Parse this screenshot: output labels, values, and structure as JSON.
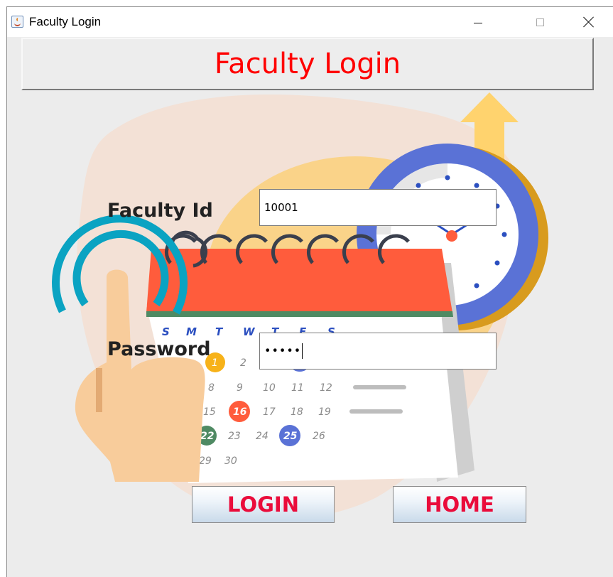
{
  "window": {
    "title": "Faculty Login",
    "icon": "java-cup-icon",
    "controls": [
      "minimize",
      "maximize",
      "close"
    ]
  },
  "header": {
    "title": "Faculty Login",
    "color": "#ff0000"
  },
  "form": {
    "faculty_id": {
      "label": "Faculty Id",
      "value": "10001"
    },
    "password": {
      "label": "Password",
      "masked_value": "•••••"
    }
  },
  "buttons": {
    "login": "LOGIN",
    "home": "HOME"
  },
  "illustration": {
    "description_icons": [
      "calendar-icon",
      "clock-icon",
      "hand-touch-icon",
      "up-arrow-icon"
    ],
    "weekdays": [
      "S",
      "M",
      "T",
      "W",
      "T",
      "F",
      "S"
    ],
    "dates": [
      "1",
      "2",
      "8",
      "9",
      "10",
      "11",
      "12",
      "15",
      "16",
      "17",
      "18",
      "19",
      "22",
      "23",
      "24",
      "25",
      "26",
      "29",
      "30"
    ],
    "colors": {
      "calendar_top": "#ff5c3c",
      "clock_ring": "#5a72d6",
      "hand": "#f8cc9b",
      "arc": "#0aa3c2",
      "arrow": "#ffd36e"
    }
  }
}
